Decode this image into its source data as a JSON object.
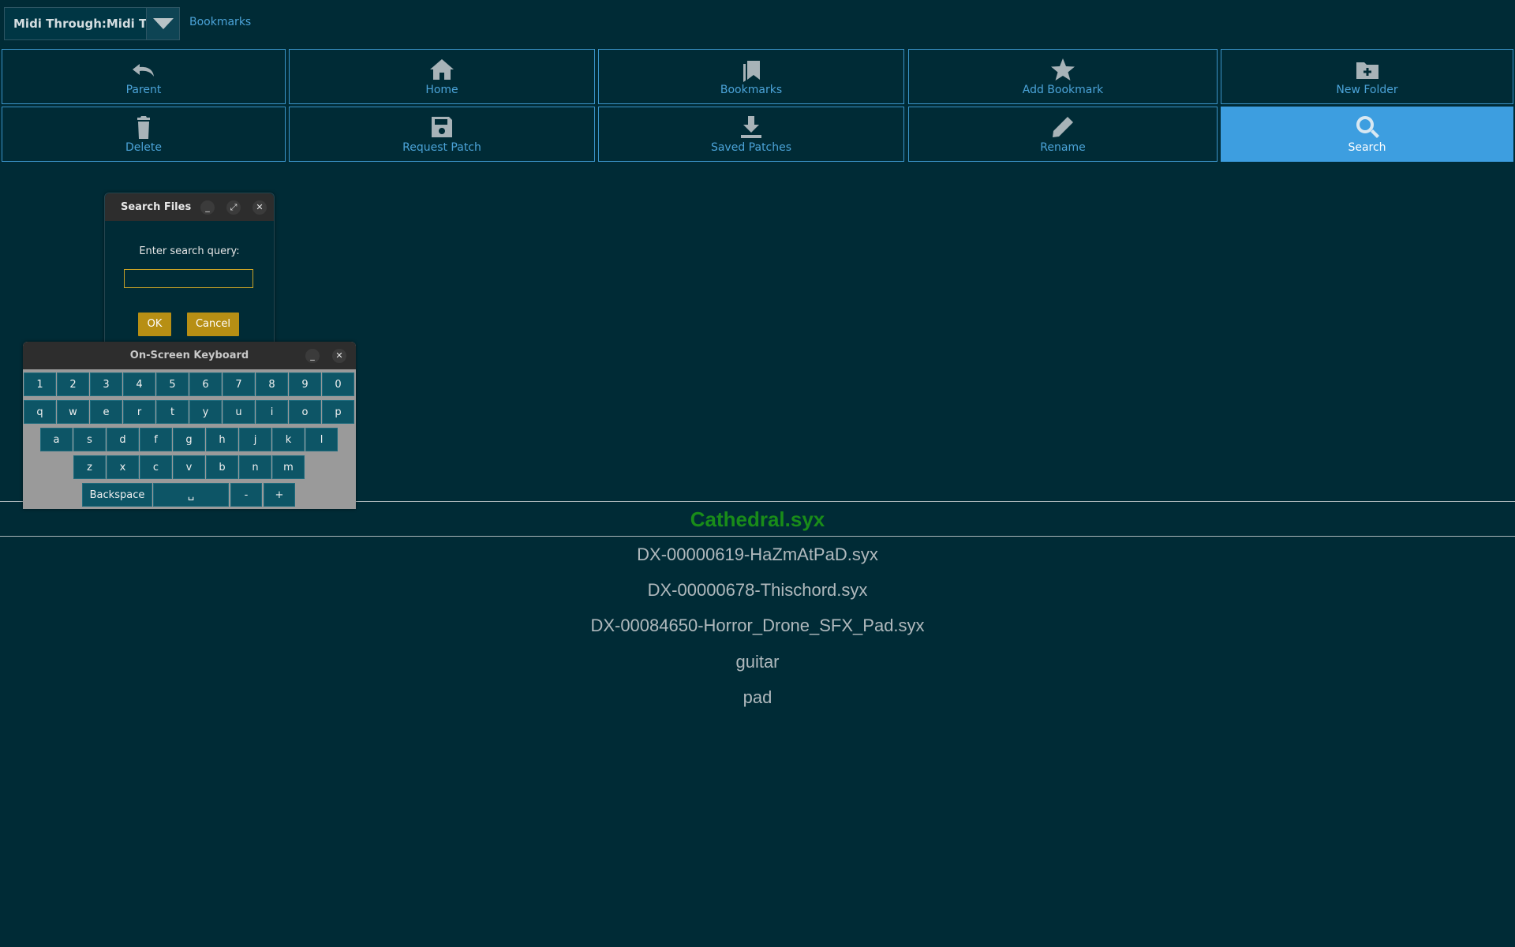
{
  "topbar": {
    "port_label": "Midi Through:Midi Thr",
    "bookmarks_link": "Bookmarks"
  },
  "toolbar": [
    {
      "label": "Parent",
      "icon": "undo-arrow-icon"
    },
    {
      "label": "Home",
      "icon": "home-icon"
    },
    {
      "label": "Bookmarks",
      "icon": "bookmarks-icon"
    },
    {
      "label": "Add Bookmark",
      "icon": "star-icon"
    },
    {
      "label": "New Folder",
      "icon": "folder-plus-icon"
    },
    {
      "label": "Delete",
      "icon": "trash-icon"
    },
    {
      "label": "Request Patch",
      "icon": "floppy-disk-icon"
    },
    {
      "label": "Saved Patches",
      "icon": "download-icon"
    },
    {
      "label": "Rename",
      "icon": "pencil-icon"
    },
    {
      "label": "Search",
      "icon": "search-icon",
      "active": true
    }
  ],
  "files": {
    "selected": "Cathedral.syx",
    "items": [
      "DX-00000619-HaZmAtPaD.syx",
      "DX-00000678-Thischord.syx",
      "DX-00084650-Horror_Drone_SFX_Pad.syx",
      "guitar",
      "pad"
    ]
  },
  "search_dialog": {
    "title": "Search Files",
    "prompt": "Enter search query:",
    "query_value": "",
    "ok_label": "OK",
    "cancel_label": "Cancel",
    "minimize_glyph": "_",
    "maximize_glyph": "⤢",
    "close_glyph": "✕"
  },
  "keyboard": {
    "title": "On-Screen Keyboard",
    "minimize_glyph": "_",
    "close_glyph": "✕",
    "rows": [
      [
        "1",
        "2",
        "3",
        "4",
        "5",
        "6",
        "7",
        "8",
        "9",
        "0"
      ],
      [
        "q",
        "w",
        "e",
        "r",
        "t",
        "y",
        "u",
        "i",
        "o",
        "p"
      ],
      [
        "a",
        "s",
        "d",
        "f",
        "g",
        "h",
        "j",
        "k",
        "l"
      ],
      [
        "z",
        "x",
        "c",
        "v",
        "b",
        "n",
        "m"
      ]
    ],
    "bottom_row": [
      "Backspace",
      "␣",
      "-",
      "+"
    ]
  },
  "colors": {
    "background": "#002b36",
    "accent": "#3d9ee0",
    "selected_file": "#198c19",
    "dialog_button": "#b78f14",
    "key": "#0d5566"
  }
}
